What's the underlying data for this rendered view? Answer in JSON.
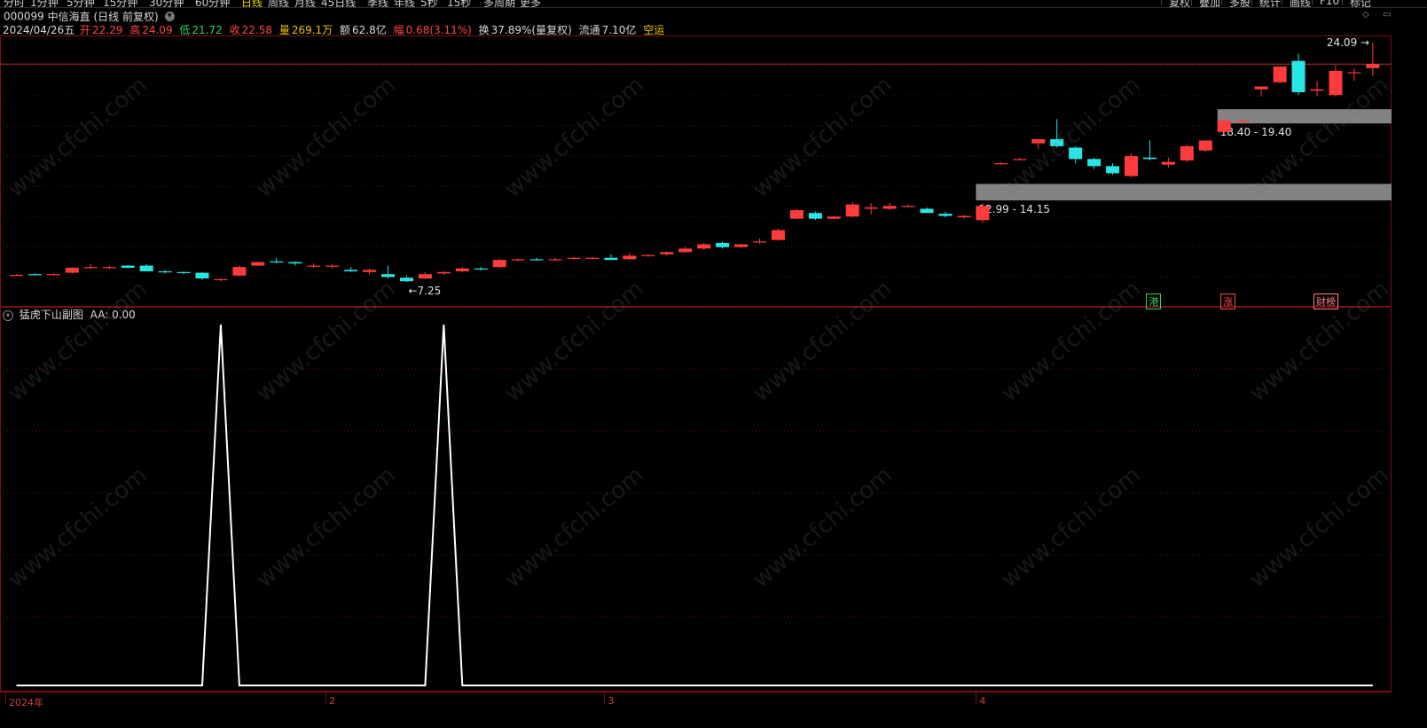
{
  "toolbar": {
    "periods": [
      "分时",
      "1分钟",
      "5分钟",
      "15分钟",
      "30分钟",
      "60分钟",
      "日线",
      "周线",
      "月线",
      "45日线",
      "季线",
      "年线",
      "5秒",
      "15秒",
      "多周期",
      "更多"
    ],
    "active_period": "日线",
    "right_buttons": [
      "复权",
      "叠加",
      "多股",
      "统计",
      "画线",
      "F10",
      "标记"
    ]
  },
  "stock": {
    "code": "000099",
    "name": "中信海直",
    "mode": "(日线 前复权)",
    "dropdown_glyph": "▾"
  },
  "quote": {
    "date": "2024/04/26五",
    "open_label": "开",
    "open": "22.29",
    "high_label": "高",
    "high": "24.09",
    "low_label": "低",
    "low": "21.72",
    "close_label": "收",
    "close": "22.58",
    "volume_label": "量",
    "volume": "269.1万",
    "amount_label": "额",
    "amount": "62.8亿",
    "change_label": "幅",
    "change": "0.68(3.11%)",
    "turnover_label": "换",
    "turnover": "37.89%(量复权)",
    "float_label": "流通",
    "float": "7.10亿",
    "tag": "空运"
  },
  "main_chart": {
    "high_annotation": "24.09",
    "low_annotation": "7.25",
    "zones": [
      {
        "label": "12.99 - 14.15",
        "low": 12.99,
        "high": 14.15,
        "color": "#9a9a9a"
      },
      {
        "label": "18.40 - 19.40",
        "low": 18.4,
        "high": 19.4,
        "color": "#9a9a9a"
      }
    ],
    "markers": [
      {
        "label": "港",
        "color": "#32d25a"
      },
      {
        "label": "涨",
        "color": "#ff4545"
      },
      {
        "label": "财榜",
        "color": "#ff8080"
      }
    ],
    "up_color": "#ff3b3b",
    "down_color": "#29e6e6"
  },
  "chart_data": {
    "type": "candlestick",
    "candles": [
      [
        7.75,
        7.8,
        7.7,
        7.75
      ],
      [
        7.8,
        7.85,
        7.72,
        7.78
      ],
      [
        7.75,
        7.85,
        7.7,
        7.8
      ],
      [
        7.9,
        8.3,
        7.85,
        8.25
      ],
      [
        8.25,
        8.5,
        8.15,
        8.3
      ],
      [
        8.25,
        8.4,
        8.15,
        8.3
      ],
      [
        8.4,
        8.45,
        8.2,
        8.25
      ],
      [
        8.4,
        8.5,
        8.0,
        8.0
      ],
      [
        8.0,
        8.1,
        7.85,
        7.95
      ],
      [
        7.95,
        8.0,
        7.8,
        7.9
      ],
      [
        7.9,
        7.95,
        7.4,
        7.5
      ],
      [
        7.4,
        7.5,
        7.3,
        7.45
      ],
      [
        7.7,
        8.4,
        7.65,
        8.3
      ],
      [
        8.4,
        8.7,
        8.35,
        8.65
      ],
      [
        8.7,
        8.95,
        8.55,
        8.65
      ],
      [
        8.65,
        8.7,
        8.4,
        8.55
      ],
      [
        8.35,
        8.55,
        8.25,
        8.4
      ],
      [
        8.35,
        8.5,
        8.2,
        8.4
      ],
      [
        8.1,
        8.3,
        7.95,
        8.0
      ],
      [
        7.95,
        8.2,
        7.8,
        8.1
      ],
      [
        7.8,
        8.4,
        7.5,
        7.6
      ],
      [
        7.55,
        7.7,
        7.25,
        7.3
      ],
      [
        7.5,
        7.95,
        7.45,
        7.8
      ],
      [
        7.85,
        8.0,
        7.75,
        7.95
      ],
      [
        8.0,
        8.3,
        7.95,
        8.2
      ],
      [
        8.2,
        8.3,
        8.05,
        8.15
      ],
      [
        8.3,
        8.9,
        8.25,
        8.8
      ],
      [
        8.8,
        8.9,
        8.7,
        8.85
      ],
      [
        8.85,
        8.95,
        8.75,
        8.82
      ],
      [
        8.85,
        8.95,
        8.75,
        8.85
      ],
      [
        8.92,
        9.0,
        8.8,
        8.95
      ],
      [
        8.95,
        9.02,
        8.85,
        8.95
      ],
      [
        8.95,
        9.2,
        8.85,
        8.8
      ],
      [
        8.85,
        9.3,
        8.8,
        9.1
      ],
      [
        9.15,
        9.2,
        9.0,
        9.15
      ],
      [
        9.2,
        9.4,
        9.1,
        9.35
      ],
      [
        9.35,
        9.75,
        9.3,
        9.6
      ],
      [
        9.6,
        10.0,
        9.5,
        9.9
      ],
      [
        10.0,
        10.1,
        9.6,
        9.7
      ],
      [
        9.7,
        9.95,
        9.65,
        9.9
      ],
      [
        10.05,
        10.3,
        9.95,
        10.1
      ],
      [
        10.2,
        11.0,
        10.15,
        10.9
      ],
      [
        11.7,
        12.4,
        11.65,
        12.3
      ],
      [
        12.1,
        12.2,
        11.6,
        11.7
      ],
      [
        11.7,
        11.9,
        11.65,
        11.85
      ],
      [
        11.85,
        12.9,
        11.8,
        12.7
      ],
      [
        12.4,
        12.8,
        12.0,
        12.5
      ],
      [
        12.4,
        12.8,
        12.3,
        12.6
      ],
      [
        12.6,
        12.7,
        12.5,
        12.6
      ],
      [
        12.4,
        12.5,
        12.1,
        12.1
      ],
      [
        12.05,
        12.2,
        11.8,
        11.9
      ],
      [
        11.8,
        11.95,
        11.7,
        11.9
      ],
      [
        11.6,
        12.8,
        11.4,
        12.6
      ],
      [
        15.6,
        15.7,
        15.5,
        15.6
      ],
      [
        15.9,
        16.0,
        15.8,
        15.9
      ],
      [
        17.0,
        17.3,
        16.6,
        17.3
      ],
      [
        17.3,
        18.7,
        16.7,
        16.8
      ],
      [
        16.7,
        16.8,
        15.6,
        15.9
      ],
      [
        15.9,
        16.0,
        15.2,
        15.4
      ],
      [
        15.4,
        15.6,
        14.8,
        14.9
      ],
      [
        14.7,
        16.3,
        14.6,
        16.1
      ],
      [
        16.0,
        17.2,
        15.8,
        15.9
      ],
      [
        15.5,
        16.0,
        15.3,
        15.7
      ],
      [
        15.8,
        16.9,
        15.7,
        16.8
      ],
      [
        16.5,
        17.2,
        16.4,
        17.2
      ],
      [
        17.8,
        18.8,
        17.7,
        18.6
      ],
      [
        18.6,
        18.7,
        18.4,
        18.6
      ],
      [
        20.8,
        21.0,
        20.3,
        21.0
      ],
      [
        21.3,
        22.4,
        21.2,
        22.4
      ],
      [
        22.8,
        23.3,
        20.4,
        20.6
      ],
      [
        20.7,
        21.4,
        20.3,
        20.8
      ],
      [
        20.4,
        22.5,
        20.3,
        22.1
      ],
      [
        22.0,
        22.3,
        21.4,
        22.0
      ],
      [
        22.29,
        24.09,
        21.72,
        22.58
      ]
    ],
    "price_high": 24.09,
    "price_low": 7.25
  },
  "sub_chart": {
    "title": "猛虎下山副图",
    "value_label": "AA: 0.00",
    "signal_series": [
      0,
      0,
      0,
      0,
      0,
      0,
      0,
      0,
      0,
      0,
      0,
      1,
      0,
      0,
      0,
      0,
      0,
      0,
      0,
      0,
      0,
      0,
      0,
      1,
      0,
      0,
      0,
      0,
      0,
      0,
      0,
      0,
      0,
      0,
      0,
      0,
      0,
      0,
      0,
      0,
      0,
      0,
      0,
      0,
      0,
      0,
      0,
      0,
      0,
      0,
      0,
      0,
      0,
      0,
      0,
      0,
      0,
      0,
      0,
      0,
      0,
      0,
      0,
      0,
      0,
      0,
      0,
      0,
      0,
      0,
      0,
      0,
      0,
      0
    ],
    "line_color": "#ffffff"
  },
  "xaxis": {
    "labels": [
      "2024年",
      "2",
      "3",
      "4"
    ],
    "label_candle_index": [
      0,
      17,
      32,
      52
    ]
  },
  "watermark": "www.cfchi.com"
}
